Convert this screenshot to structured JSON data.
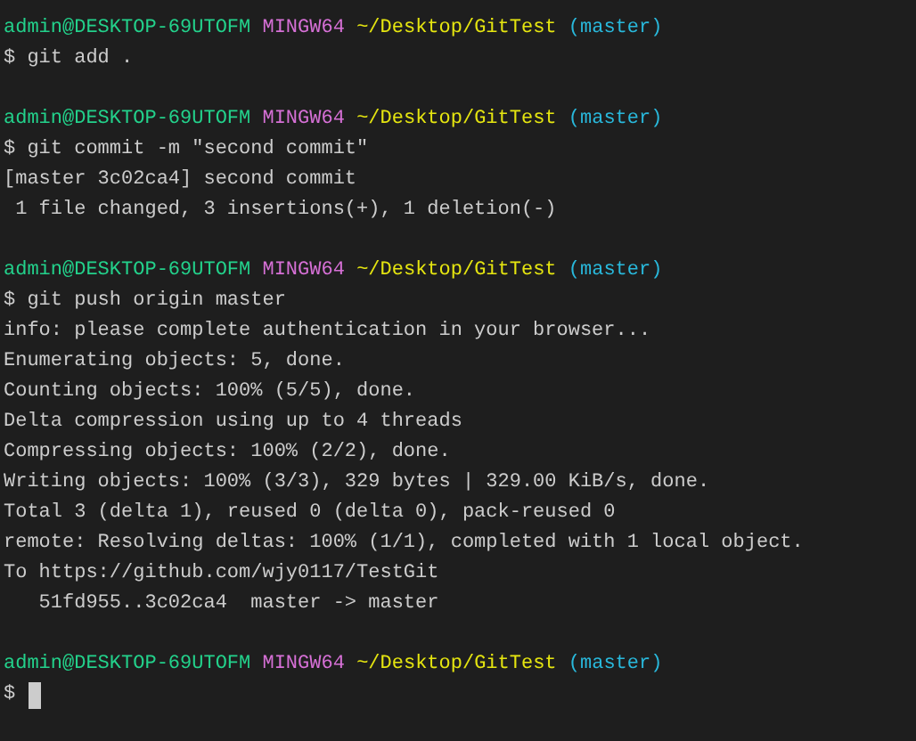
{
  "lines": [
    {
      "kind": "prompt",
      "user": "admin@DESKTOP-69UTOFM",
      "shell": "MINGW64",
      "path": "~/Desktop/GitTest",
      "branch": "(master)"
    },
    {
      "kind": "command",
      "text": "$ git add ."
    },
    {
      "kind": "blank"
    },
    {
      "kind": "prompt",
      "user": "admin@DESKTOP-69UTOFM",
      "shell": "MINGW64",
      "path": "~/Desktop/GitTest",
      "branch": "(master)"
    },
    {
      "kind": "command",
      "text": "$ git commit -m \"second commit\""
    },
    {
      "kind": "output",
      "text": "[master 3c02ca4] second commit"
    },
    {
      "kind": "output",
      "text": " 1 file changed, 3 insertions(+), 1 deletion(-)"
    },
    {
      "kind": "blank"
    },
    {
      "kind": "prompt",
      "user": "admin@DESKTOP-69UTOFM",
      "shell": "MINGW64",
      "path": "~/Desktop/GitTest",
      "branch": "(master)"
    },
    {
      "kind": "command",
      "text": "$ git push origin master"
    },
    {
      "kind": "output",
      "text": "info: please complete authentication in your browser..."
    },
    {
      "kind": "output",
      "text": "Enumerating objects: 5, done."
    },
    {
      "kind": "output",
      "text": "Counting objects: 100% (5/5), done."
    },
    {
      "kind": "output",
      "text": "Delta compression using up to 4 threads"
    },
    {
      "kind": "output",
      "text": "Compressing objects: 100% (2/2), done."
    },
    {
      "kind": "output",
      "text": "Writing objects: 100% (3/3), 329 bytes | 329.00 KiB/s, done."
    },
    {
      "kind": "output",
      "text": "Total 3 (delta 1), reused 0 (delta 0), pack-reused 0"
    },
    {
      "kind": "output",
      "text": "remote: Resolving deltas: 100% (1/1), completed with 1 local object."
    },
    {
      "kind": "output",
      "text": "To https://github.com/wjy0117/TestGit"
    },
    {
      "kind": "output",
      "text": "   51fd955..3c02ca4  master -> master"
    },
    {
      "kind": "blank"
    },
    {
      "kind": "prompt",
      "user": "admin@DESKTOP-69UTOFM",
      "shell": "MINGW64",
      "path": "~/Desktop/GitTest",
      "branch": "(master)"
    },
    {
      "kind": "input",
      "text": "$"
    }
  ]
}
